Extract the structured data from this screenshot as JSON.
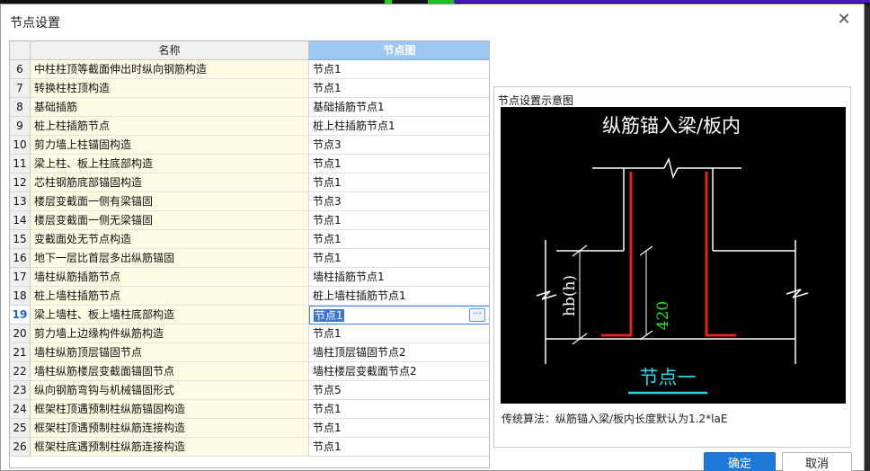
{
  "dialog": {
    "title": "节点设置"
  },
  "table": {
    "headers": {
      "name": "名称",
      "node": "节点图"
    },
    "rows": [
      {
        "num": "6",
        "name": "中柱柱顶等截面伸出时纵向钢筋构造",
        "node": "节点1"
      },
      {
        "num": "7",
        "name": "转换柱柱顶构造",
        "node": "节点1"
      },
      {
        "num": "8",
        "name": "基础插筋",
        "node": "基础插筋节点1"
      },
      {
        "num": "9",
        "name": "桩上柱插筋节点",
        "node": "桩上柱插筋节点1"
      },
      {
        "num": "10",
        "name": "剪力墙上柱锚固构造",
        "node": "节点3"
      },
      {
        "num": "11",
        "name": "梁上柱、板上柱底部构造",
        "node": "节点1"
      },
      {
        "num": "12",
        "name": "芯柱钢筋底部锚固构造",
        "node": "节点1"
      },
      {
        "num": "13",
        "name": "楼层变截面一侧有梁锚固",
        "node": "节点3"
      },
      {
        "num": "14",
        "name": "楼层变截面一侧无梁锚固",
        "node": "节点1"
      },
      {
        "num": "15",
        "name": "变截面处无节点构造",
        "node": "节点1"
      },
      {
        "num": "16",
        "name": "地下一层比首层多出纵筋锚固",
        "node": "节点1"
      },
      {
        "num": "17",
        "name": "墙柱纵筋插筋节点",
        "node": "墙柱插筋节点1"
      },
      {
        "num": "18",
        "name": "桩上墙柱插筋节点",
        "node": "桩上墙柱插筋节点1"
      },
      {
        "num": "19",
        "name": "梁上墙柱、板上墙柱底部构造",
        "node": "节点1"
      },
      {
        "num": "20",
        "name": "剪力墙上边缘构件纵筋构造",
        "node": "节点1"
      },
      {
        "num": "21",
        "name": "墙柱纵筋顶层锚固节点",
        "node": "墙柱顶层锚固节点2"
      },
      {
        "num": "22",
        "name": "墙柱纵筋楼层变截面锚固节点",
        "node": "墙柱楼层变截面节点2"
      },
      {
        "num": "23",
        "name": "纵向钢筋弯钩与机械锚固形式",
        "node": "节点5"
      },
      {
        "num": "24",
        "name": "框架柱顶遇预制柱纵筋锚固构造",
        "node": "节点1"
      },
      {
        "num": "25",
        "name": "框架柱顶遇预制柱纵筋连接构造",
        "node": "节点1"
      },
      {
        "num": "26",
        "name": "框架柱底遇预制柱纵筋连接构造",
        "node": "节点1"
      }
    ],
    "selected_index": 13,
    "ellipsis_label": "···"
  },
  "preview": {
    "label": "节点设置示意图",
    "diagram_title": "纵筋锚入梁/板内",
    "dim_hb": "hb(h)",
    "dim_value": "420",
    "node_caption": "节点一",
    "description": "传统算法：纵筋锚入梁/板内长度默认为1.2*laE",
    "colors": {
      "rebar": "#e82020",
      "dim_value": "#2ee02e",
      "caption": "#27d7e7"
    }
  },
  "buttons": {
    "ok": "确定",
    "cancel": "取消"
  },
  "icons": {
    "close": "close-icon",
    "ellipsis": "ellipsis-icon"
  }
}
